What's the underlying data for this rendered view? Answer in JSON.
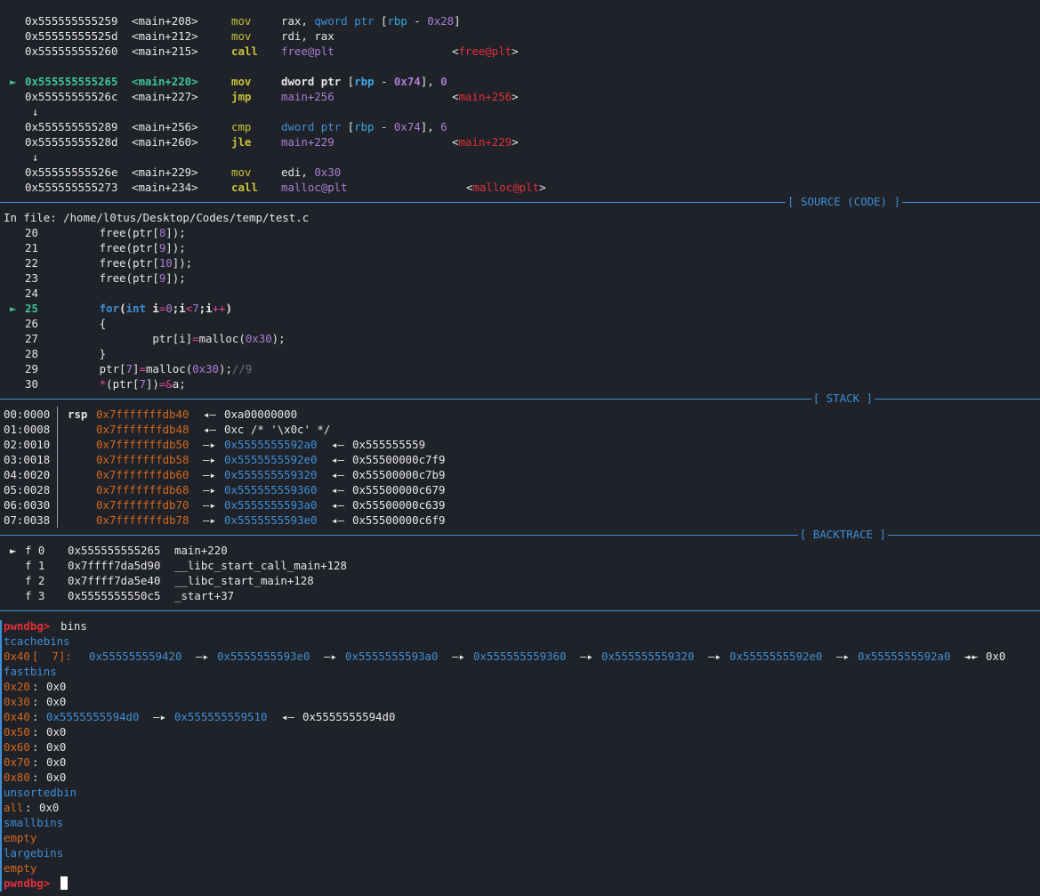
{
  "disasm": [
    {
      "marker": "",
      "addr": "0x555555555259",
      "sym": "<main+208>",
      "op": "mov",
      "args": "rax, qword ptr [rbp - 0x28]",
      "cmt": ""
    },
    {
      "marker": "",
      "addr": "0x55555555525d",
      "sym": "<main+212>",
      "op": "mov",
      "args": "rdi, rax",
      "cmt": ""
    },
    {
      "marker": "",
      "addr": "0x555555555260",
      "sym": "<main+215>",
      "op": "call",
      "args": "free@plt",
      "cmt": "<free@plt>"
    },
    {
      "marker": "►",
      "addr": "0x555555555265",
      "sym": "<main+220>",
      "op": "mov",
      "args": "dword ptr [rbp - 0x74], 0",
      "cmt": ""
    },
    {
      "marker": "",
      "addr": "0x55555555526c",
      "sym": "<main+227>",
      "op": "jmp",
      "args": "main+256",
      "cmt": "<main+256>"
    },
    {
      "marker": "",
      "addr": "0x555555555289",
      "sym": "<main+256>",
      "op": "cmp",
      "args": "dword ptr [rbp - 0x74], 6",
      "cmt": ""
    },
    {
      "marker": "",
      "addr": "0x55555555528d",
      "sym": "<main+260>",
      "op": "jle",
      "args": "main+229",
      "cmt": "<main+229>"
    },
    {
      "marker": "",
      "addr": "0x55555555526e",
      "sym": "<main+229>",
      "op": "mov",
      "args": "edi, 0x30",
      "cmt": ""
    },
    {
      "marker": "",
      "addr": "0x555555555273",
      "sym": "<main+234>",
      "op": "call",
      "args": "malloc@plt",
      "cmt": "<malloc@plt>"
    }
  ],
  "jump_arrow": "↓",
  "sections": {
    "source": "[ SOURCE (CODE) ]",
    "stack": "[ STACK ]",
    "backtrace": "[ BACKTRACE ]"
  },
  "source": {
    "file_line": "In file: /home/l0tus/Desktop/Codes/temp/test.c",
    "lines": [
      {
        "marker": "",
        "num": "20",
        "code": "        free(ptr[8]);"
      },
      {
        "marker": "",
        "num": "21",
        "code": "        free(ptr[9]);"
      },
      {
        "marker": "",
        "num": "22",
        "code": "        free(ptr[10]);"
      },
      {
        "marker": "",
        "num": "23",
        "code": "        free(ptr[9]);"
      },
      {
        "marker": "",
        "num": "24",
        "code": ""
      },
      {
        "marker": "►",
        "num": "25",
        "code": "        for(int i=0;i<7;i++)"
      },
      {
        "marker": "",
        "num": "26",
        "code": "        {"
      },
      {
        "marker": "",
        "num": "27",
        "code": "                ptr[i]=malloc(0x30);"
      },
      {
        "marker": "",
        "num": "28",
        "code": "        }"
      },
      {
        "marker": "",
        "num": "29",
        "code": "        ptr[7]=malloc(0x30);//9"
      },
      {
        "marker": "",
        "num": "30",
        "code": "        *(ptr[7])=&a;"
      }
    ]
  },
  "stack": [
    {
      "idx": "00:0000",
      "reg": "rsp",
      "addr": "0x7fffffffdb40",
      "a1": "◂—",
      "v1": "",
      "a2": "",
      "v2": "0xa00000000"
    },
    {
      "idx": "01:0008",
      "reg": "",
      "addr": "0x7fffffffdb48",
      "a1": "◂—",
      "v1": "",
      "a2": "",
      "v2": "0xc /* '\\x0c' */"
    },
    {
      "idx": "02:0010",
      "reg": "",
      "addr": "0x7fffffffdb50",
      "a1": "—▸",
      "v1": "0x5555555592a0",
      "a2": "◂—",
      "v2": "0x555555559"
    },
    {
      "idx": "03:0018",
      "reg": "",
      "addr": "0x7fffffffdb58",
      "a1": "—▸",
      "v1": "0x5555555592e0",
      "a2": "◂—",
      "v2": "0x55500000c7f9"
    },
    {
      "idx": "04:0020",
      "reg": "",
      "addr": "0x7fffffffdb60",
      "a1": "—▸",
      "v1": "0x555555559320",
      "a2": "◂—",
      "v2": "0x55500000c7b9"
    },
    {
      "idx": "05:0028",
      "reg": "",
      "addr": "0x7fffffffdb68",
      "a1": "—▸",
      "v1": "0x555555559360",
      "a2": "◂—",
      "v2": "0x55500000c679"
    },
    {
      "idx": "06:0030",
      "reg": "",
      "addr": "0x7fffffffdb70",
      "a1": "—▸",
      "v1": "0x5555555593a0",
      "a2": "◂—",
      "v2": "0x55500000c639"
    },
    {
      "idx": "07:0038",
      "reg": "",
      "addr": "0x7fffffffdb78",
      "a1": "—▸",
      "v1": "0x5555555593e0",
      "a2": "◂—",
      "v2": "0x55500000c6f9"
    }
  ],
  "backtrace": [
    {
      "marker": "►",
      "frame": "f 0",
      "addr": "0x555555555265",
      "sym": "main+220"
    },
    {
      "marker": "",
      "frame": "f 1",
      "addr": "0x7ffff7da5d90",
      "sym": "__libc_start_call_main+128"
    },
    {
      "marker": "",
      "frame": "f 2",
      "addr": "0x7ffff7da5e40",
      "sym": "__libc_start_main+128"
    },
    {
      "marker": "",
      "frame": "f 3",
      "addr": "0x5555555550c5",
      "sym": "_start+37"
    }
  ],
  "prompt": "pwndbg>",
  "command": "bins",
  "bins": {
    "tcache_title": "tcachebins",
    "tcache_size": "0x40",
    "tcache_count": "[  7]:",
    "tcache_chain": [
      "0x555555559420",
      "0x5555555593e0",
      "0x5555555593a0",
      "0x555555559360",
      "0x555555559320",
      "0x5555555592e0",
      "0x5555555592a0"
    ],
    "tcache_end": "0x0",
    "fast_title": "fastbins",
    "fast": [
      {
        "size": "0x20",
        "val": "0x0"
      },
      {
        "size": "0x30",
        "val": "0x0"
      },
      {
        "size": "0x40",
        "chain": [
          "0x5555555594d0",
          "0x555555559510"
        ],
        "end": "0x5555555594d0"
      },
      {
        "size": "0x50",
        "val": "0x0"
      },
      {
        "size": "0x60",
        "val": "0x0"
      },
      {
        "size": "0x70",
        "val": "0x0"
      },
      {
        "size": "0x80",
        "val": "0x0"
      }
    ],
    "unsorted_title": "unsortedbin",
    "unsorted_key": "all",
    "unsorted_val": "0x0",
    "small_title": "smallbins",
    "small_val": "empty",
    "large_title": "largebins",
    "large_val": "empty"
  },
  "arrows": {
    "fwd": "—▸",
    "back": "◂—"
  }
}
